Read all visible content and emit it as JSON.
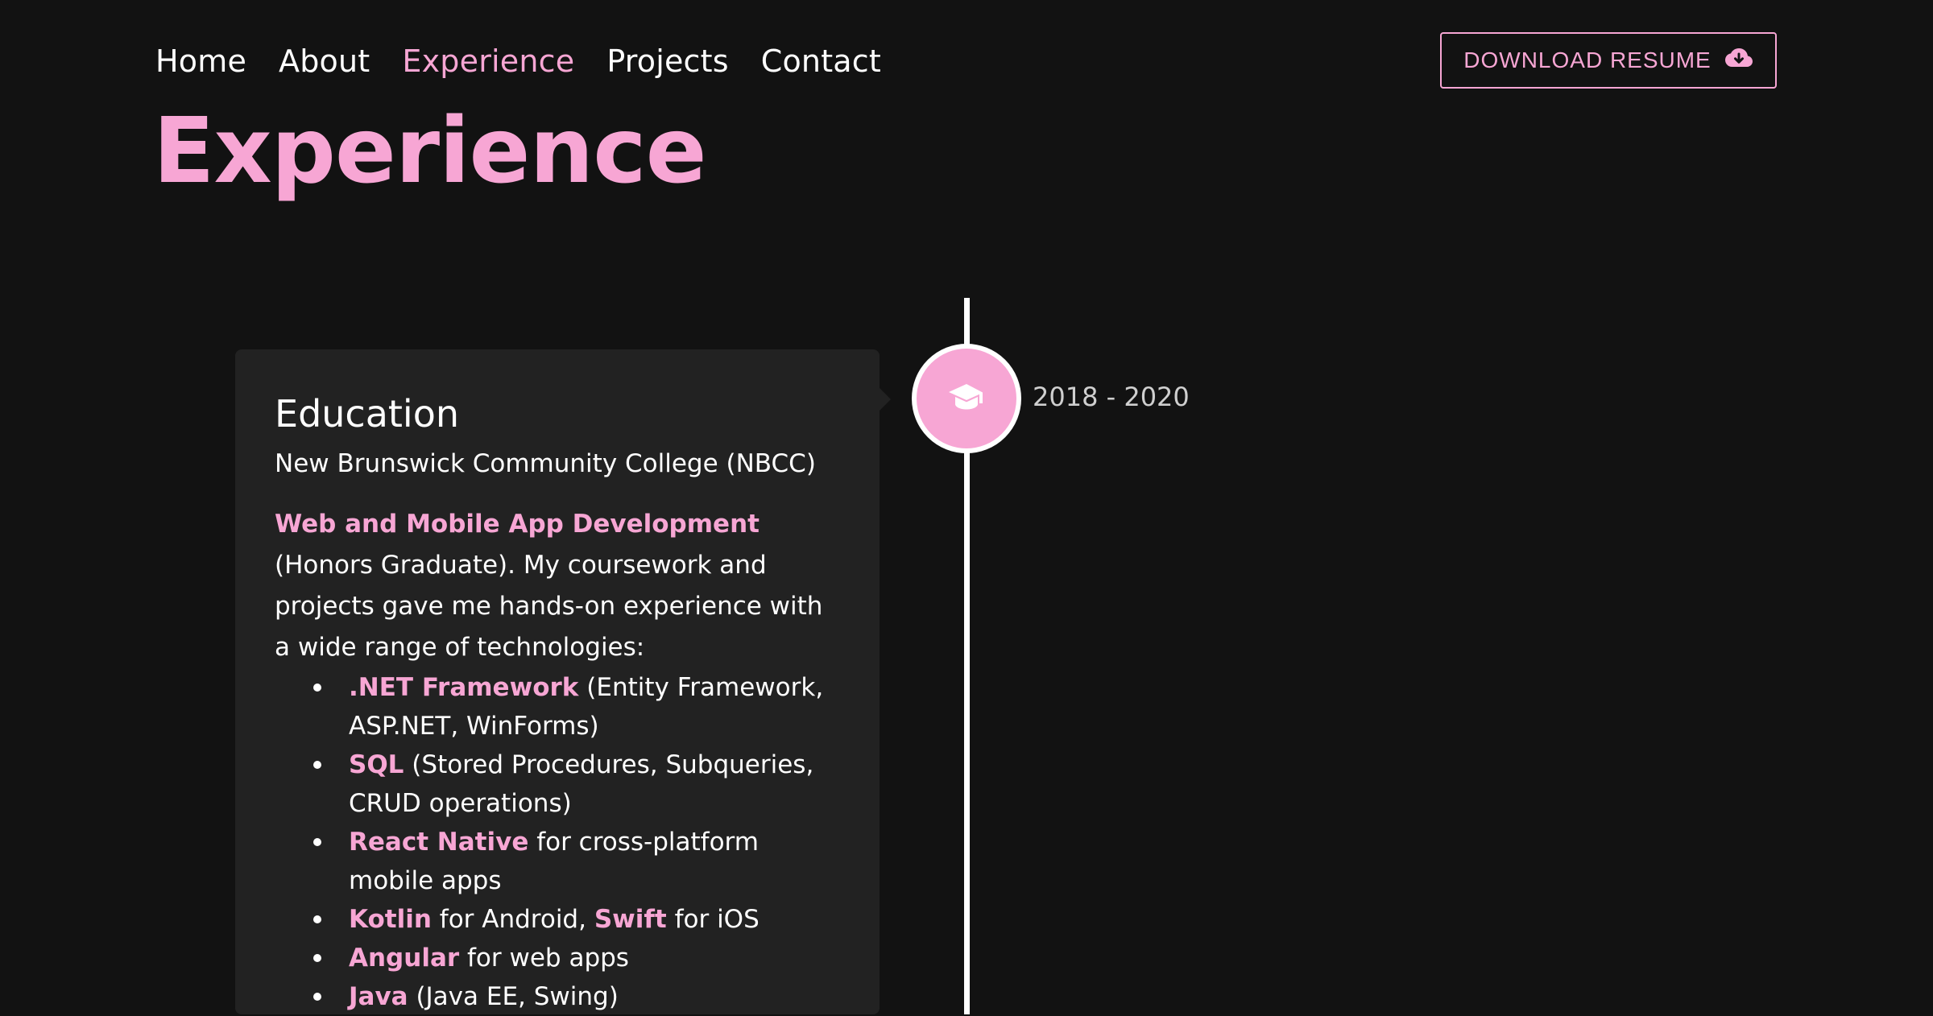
{
  "nav": {
    "items": [
      {
        "label": "Home",
        "active": false
      },
      {
        "label": "About",
        "active": false
      },
      {
        "label": "Experience",
        "active": true
      },
      {
        "label": "Projects",
        "active": false
      },
      {
        "label": "Contact",
        "active": false
      }
    ],
    "resume_button": {
      "label": "DOWNLOAD RESUME",
      "icon": "cloud-download-icon"
    }
  },
  "page": {
    "title": "Experience",
    "accent_color": "#f7a6d4",
    "background_color": "#121212"
  },
  "timeline": {
    "entries": [
      {
        "date": "2018 - 2020",
        "icon": "graduation-cap-icon",
        "title": "Education",
        "subtitle": "New Brunswick Community College (NBCC)",
        "description_highlight": "Web and Mobile App Development",
        "description_rest": " (Honors Graduate). My coursework and projects gave me hands-on experience with a wide range of technologies:",
        "technologies": [
          {
            "parts": [
              {
                "text": ".NET Framework",
                "hl": true
              },
              {
                "text": " (Entity Framework, ASP.NET, WinForms)",
                "hl": false
              }
            ]
          },
          {
            "parts": [
              {
                "text": "SQL",
                "hl": true
              },
              {
                "text": " (Stored Procedures, Subqueries, CRUD operations)",
                "hl": false
              }
            ]
          },
          {
            "parts": [
              {
                "text": "React Native",
                "hl": true
              },
              {
                "text": " for cross-platform mobile apps",
                "hl": false
              }
            ]
          },
          {
            "parts": [
              {
                "text": "Kotlin",
                "hl": true
              },
              {
                "text": " for Android, ",
                "hl": false
              },
              {
                "text": "Swift",
                "hl": true
              },
              {
                "text": " for iOS",
                "hl": false
              }
            ]
          },
          {
            "parts": [
              {
                "text": "Angular",
                "hl": true
              },
              {
                "text": " for web apps",
                "hl": false
              }
            ]
          },
          {
            "parts": [
              {
                "text": "Java",
                "hl": true
              },
              {
                "text": " (Java EE, Swing)",
                "hl": false
              }
            ]
          }
        ]
      }
    ]
  }
}
